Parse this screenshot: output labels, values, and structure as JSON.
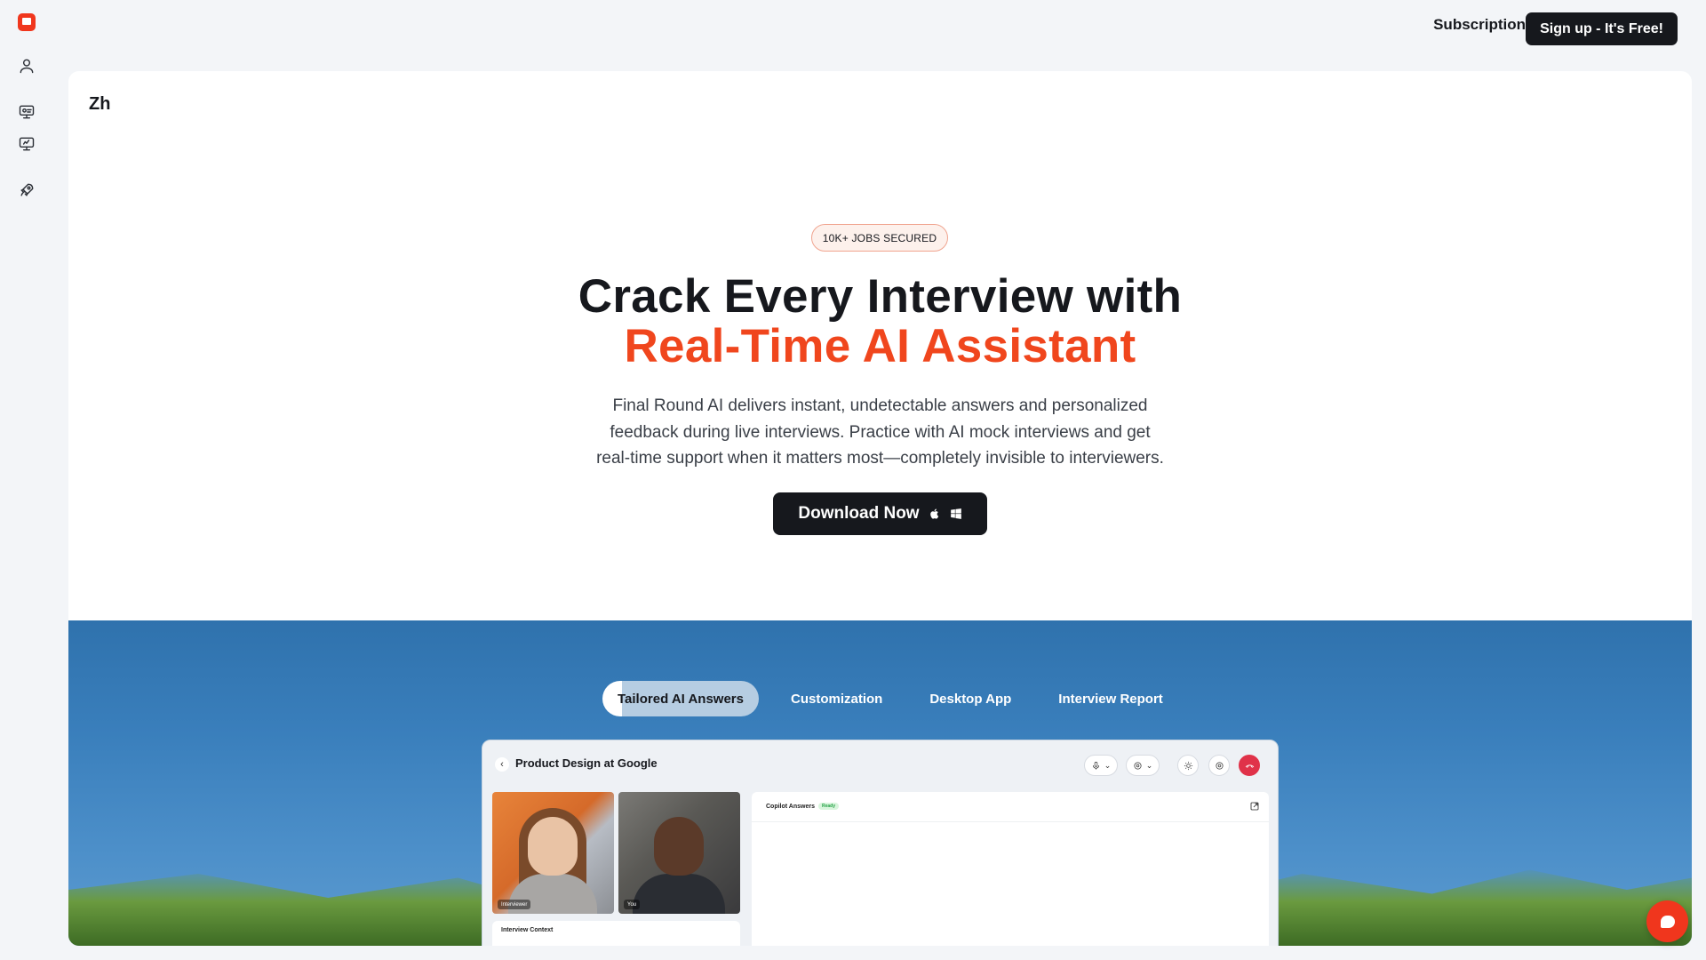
{
  "header": {
    "subscription_label": "Subscription",
    "signup_label": "Sign up - It's Free!"
  },
  "rail": {
    "icons": [
      "logo-icon",
      "user-icon",
      "interview-copilot-icon",
      "mock-interview-icon",
      "rocket-icon"
    ]
  },
  "language": {
    "label": "Zh"
  },
  "hero": {
    "badge": "10K+ JOBS SECURED",
    "title_line1": "Crack Every Interview with",
    "title_line2": "Real-Time AI Assistant",
    "description_lines": [
      "Final Round AI delivers instant, undetectable answers and personalized",
      "feedback during live interviews. Practice with AI mock interviews and get",
      "real-time support when it matters most—completely invisible to interviewers."
    ],
    "download_label": "Download Now"
  },
  "feature_tabs": {
    "items": [
      {
        "label": "Tailored AI Answers",
        "active": true
      },
      {
        "label": "Customization",
        "active": false
      },
      {
        "label": "Desktop App",
        "active": false
      },
      {
        "label": "Interview Report",
        "active": false
      }
    ]
  },
  "preview": {
    "title": "Product Design at Google",
    "interviewer_tag": "Interviewer",
    "you_tag": "You",
    "context_title": "Interview Context",
    "answers_title": "Copilot Answers",
    "answers_status": "Ready"
  },
  "colors": {
    "brand": "#f0361d",
    "title_accent": "#f0461d",
    "dark": "#16181d",
    "sky": "#3a7fbc",
    "end_call": "#e03249"
  }
}
